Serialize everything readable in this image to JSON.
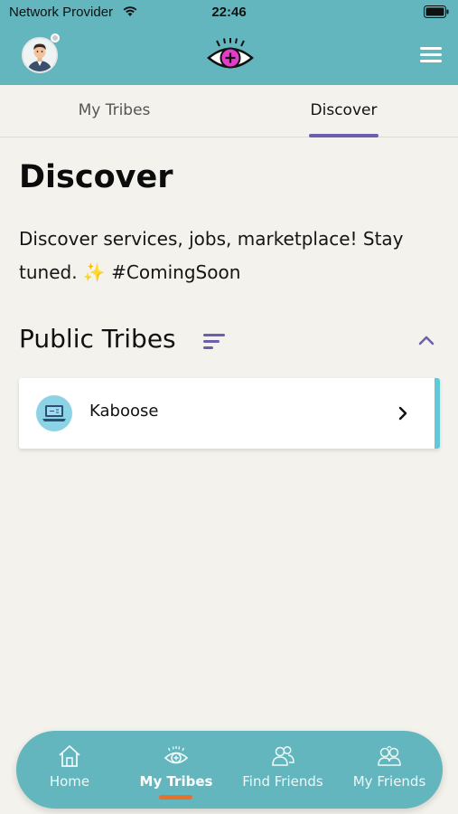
{
  "status_bar": {
    "carrier": "Network Provider",
    "time": "22:46"
  },
  "app_bar": {
    "avatar_icon": "user-avatar",
    "logo_icon": "eye-plus-logo",
    "menu_icon": "hamburger-menu"
  },
  "tabs": [
    {
      "label": "My Tribes",
      "active": false
    },
    {
      "label": "Discover",
      "active": true
    }
  ],
  "main": {
    "title": "Discover",
    "description": "Discover services, jobs, marketplace! Stay tuned. ✨ #ComingSoon",
    "section_title": "Public Tribes",
    "tribes": [
      {
        "name": "Kaboose",
        "icon": "laptop-icon"
      }
    ]
  },
  "bottom_nav": {
    "items": [
      {
        "label": "Home",
        "icon": "home-icon",
        "active": false
      },
      {
        "label": "My Tribes",
        "icon": "eye-icon",
        "active": true
      },
      {
        "label": "Find Friends",
        "icon": "people-icon",
        "active": false
      },
      {
        "label": "My Friends",
        "icon": "friends-icon",
        "active": false
      }
    ]
  },
  "colors": {
    "header_bg": "#63b6bd",
    "page_bg": "#f3f2ec",
    "accent_purple": "#6e5eab",
    "active_underline": "#e9702a",
    "card_edge": "#63c9d9"
  }
}
